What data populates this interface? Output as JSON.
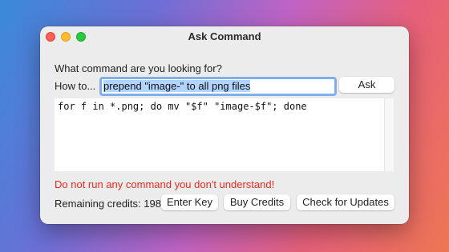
{
  "window": {
    "title": "Ask Command"
  },
  "form": {
    "prompt": "What command are you looking for?",
    "howto_label": "How to...",
    "query_value": "prepend \"image-\" to all png files",
    "ask_label": "Ask"
  },
  "output": {
    "command": "for f in *.png; do mv \"$f\" \"image-$f\"; done"
  },
  "warning": "Do not run any command you don't understand!",
  "footer": {
    "credits_label": "Remaining credits: 198",
    "enter_key_label": "Enter Key",
    "buy_credits_label": "Buy Credits",
    "updates_label": "Check for Updates"
  },
  "colors": {
    "warning": "#e52b1f",
    "focus_ring": "#7fb0ec",
    "selection": "#b3d4fc",
    "traffic_close": "#fe5f57",
    "traffic_minimize": "#febc2e",
    "traffic_maximize": "#28c840"
  },
  "icons": [
    "close-icon",
    "minimize-icon",
    "maximize-icon"
  ]
}
